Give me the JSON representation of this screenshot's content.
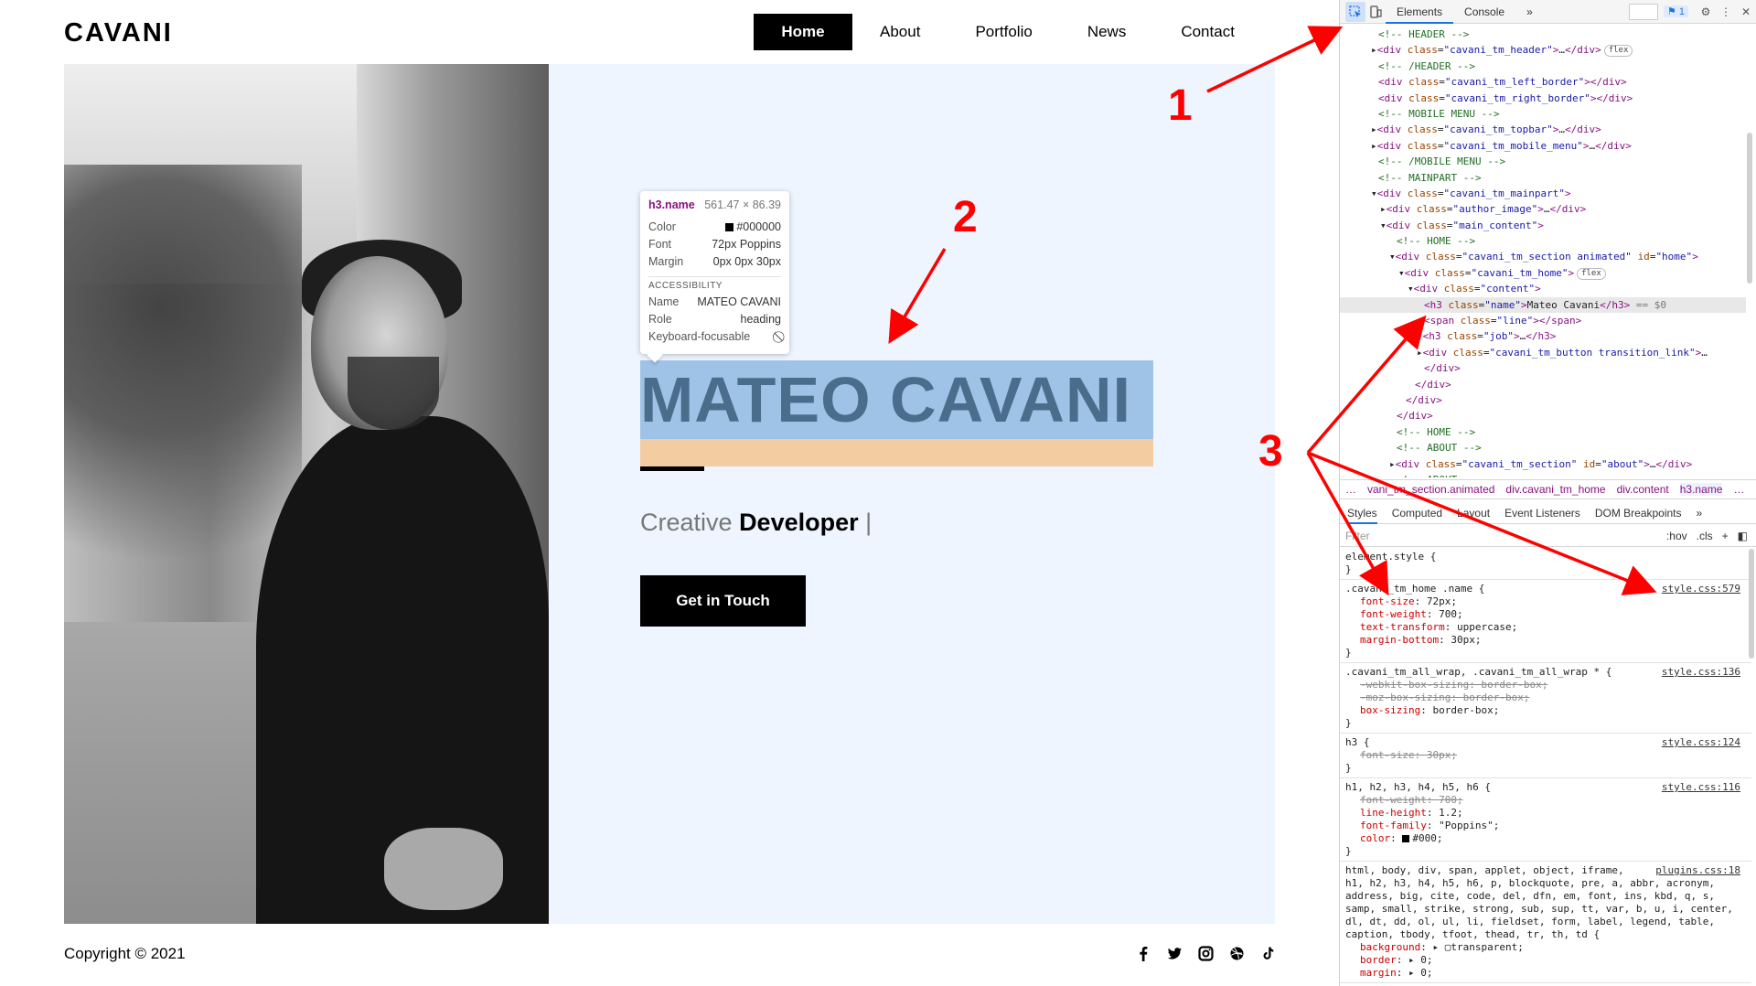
{
  "site": {
    "logo": "CAVANI",
    "nav": [
      "Home",
      "About",
      "Portfolio",
      "News",
      "Contact"
    ],
    "hero": {
      "name": "MATEO CAVANI",
      "job_prefix": "Creative",
      "job_strong": "Developer",
      "cursor": "|",
      "cta": "Get in Touch"
    },
    "footer": {
      "copyright": "Copyright © 2021"
    },
    "social_icons": [
      "facebook-icon",
      "twitter-icon",
      "instagram-icon",
      "dribbble-icon",
      "tiktok-icon"
    ],
    "colors": {
      "hero_bg": "#eef5ff",
      "highlight": "#9fc2e7",
      "margin_highlight": "#f3cca2",
      "name_text": "#4a6d8c"
    }
  },
  "tooltip": {
    "element": "h3.name",
    "size": "561.47 × 86.39",
    "rows": [
      {
        "k": "Color",
        "v": "#000000"
      },
      {
        "k": "Font",
        "v": "72px Poppins"
      },
      {
        "k": "Margin",
        "v": "0px 0px 30px"
      }
    ],
    "accessibility_title": "ACCESSIBILITY",
    "a11y": [
      {
        "k": "Name",
        "v": "MATEO CAVANI"
      },
      {
        "k": "Role",
        "v": "heading"
      },
      {
        "k": "Keyboard-focusable",
        "v": "⃠"
      }
    ]
  },
  "annotations": [
    "1",
    "2",
    "3"
  ],
  "devtools": {
    "tabs": [
      "Elements",
      "Console"
    ],
    "more": "»",
    "badge": "1",
    "dom_lines": [
      {
        "html": "<span class='cmt'>&lt;!-- HEADER --&gt;</span>",
        "indent": 42
      },
      {
        "html": "▸<span class='tag'>&lt;div</span> <span class='attr'>class</span>=<span class='val'>\"cavani_tm_header\"</span><span class='tag'>&gt;</span>…<span class='tag'>&lt;/div&gt;</span><span class='flex'>flex</span>",
        "indent": 34
      },
      {
        "html": "<span class='cmt'>&lt;!-- /HEADER --&gt;</span>",
        "indent": 42
      },
      {
        "html": "<span class='tag'>&lt;div</span> <span class='attr'>class</span>=<span class='val'>\"cavani_tm_left_border\"</span><span class='tag'>&gt;&lt;/div&gt;</span>",
        "indent": 42
      },
      {
        "html": "<span class='tag'>&lt;div</span> <span class='attr'>class</span>=<span class='val'>\"cavani_tm_right_border\"</span><span class='tag'>&gt;&lt;/div&gt;</span>",
        "indent": 42
      },
      {
        "html": "<span class='cmt'>&lt;!-- MOBILE MENU --&gt;</span>",
        "indent": 42
      },
      {
        "html": "▸<span class='tag'>&lt;div</span> <span class='attr'>class</span>=<span class='val'>\"cavani_tm_topbar\"</span><span class='tag'>&gt;</span>…<span class='tag'>&lt;/div&gt;</span>",
        "indent": 34
      },
      {
        "html": "▸<span class='tag'>&lt;div</span> <span class='attr'>class</span>=<span class='val'>\"cavani_tm_mobile_menu\"</span><span class='tag'>&gt;</span>…<span class='tag'>&lt;/div&gt;</span>",
        "indent": 34
      },
      {
        "html": "<span class='cmt'>&lt;!-- /MOBILE MENU --&gt;</span>",
        "indent": 42
      },
      {
        "html": "<span class='cmt'>&lt;!-- MAINPART --&gt;</span>",
        "indent": 42
      },
      {
        "html": "▾<span class='tag'>&lt;div</span> <span class='attr'>class</span>=<span class='val'>\"cavani_tm_mainpart\"</span><span class='tag'>&gt;</span>",
        "indent": 34
      },
      {
        "html": "▸<span class='tag'>&lt;div</span> <span class='attr'>class</span>=<span class='val'>\"author_image\"</span><span class='tag'>&gt;</span>…<span class='tag'>&lt;/div&gt;</span>",
        "indent": 44
      },
      {
        "html": "▾<span class='tag'>&lt;div</span> <span class='attr'>class</span>=<span class='val'>\"main_content\"</span><span class='tag'>&gt;</span>",
        "indent": 44
      },
      {
        "html": "<span class='cmt'>&lt;!-- HOME --&gt;</span>",
        "indent": 62
      },
      {
        "html": "▾<span class='tag'>&lt;div</span> <span class='attr'>class</span>=<span class='val'>\"cavani_tm_section animated\"</span> <span class='attr'>id</span>=<span class='val'>\"home\"</span><span class='tag'>&gt;</span>",
        "indent": 54
      },
      {
        "html": "▾<span class='tag'>&lt;div</span> <span class='attr'>class</span>=<span class='val'>\"cavani_tm_home\"</span><span class='tag'>&gt;</span><span class='flex'>flex</span>",
        "indent": 64
      },
      {
        "html": "▾<span class='tag'>&lt;div</span> <span class='attr'>class</span>=<span class='val'>\"content\"</span><span class='tag'>&gt;</span>",
        "indent": 74
      },
      {
        "html": "<span class='tag'>&lt;h3</span> <span class='attr'>class</span>=<span class='val'>\"name\"</span><span class='tag'>&gt;</span>Mateo Cavani<span class='tag'>&lt;/h3&gt;</span> <span style='color:#777'>== $0</span>",
        "indent": 92,
        "sel": true
      },
      {
        "html": "<span class='tag'>&lt;span</span> <span class='attr'>class</span>=<span class='val'>\"line\"</span><span class='tag'>&gt;&lt;/span&gt;</span>",
        "indent": 92
      },
      {
        "html": "▸<span class='tag'>&lt;h3</span> <span class='attr'>class</span>=<span class='val'>\"job\"</span><span class='tag'>&gt;</span>…<span class='tag'>&lt;/h3&gt;</span>",
        "indent": 84
      },
      {
        "html": "▸<span class='tag'>&lt;div</span> <span class='attr'>class</span>=<span class='val'>\"cavani_tm_button transition_link\"</span><span class='tag'>&gt;</span>…",
        "indent": 84
      },
      {
        "html": "<span class='tag'>&lt;/div&gt;</span>",
        "indent": 92
      },
      {
        "html": "<span class='tag'>&lt;/div&gt;</span>",
        "indent": 82
      },
      {
        "html": "<span class='tag'>&lt;/div&gt;</span>",
        "indent": 72
      },
      {
        "html": "<span class='tag'>&lt;/div&gt;</span>",
        "indent": 62
      },
      {
        "html": "<span class='cmt'>&lt;!-- HOME --&gt;</span>",
        "indent": 62
      },
      {
        "html": "<span class='cmt'>&lt;!-- ABOUT --&gt;</span>",
        "indent": 62
      },
      {
        "html": "▸<span class='tag'>&lt;div</span> <span class='attr'>class</span>=<span class='val'>\"cavani_tm_section\"</span> <span class='attr'>id</span>=<span class='val'>\"about\"</span><span class='tag'>&gt;</span>…<span class='tag'>&lt;/div&gt;</span>",
        "indent": 54
      },
      {
        "html": "<span class='cmt'>&lt;!-- ABOUT --&gt;</span>",
        "indent": 62
      }
    ],
    "crumbs": [
      "…",
      "vani_tm_section.animated",
      "div.cavani_tm_home",
      "div.content",
      "h3.name",
      "…"
    ],
    "style_tabs": [
      "Styles",
      "Computed",
      "Layout",
      "Event Listeners",
      "DOM Breakpoints",
      "»"
    ],
    "filter": {
      "placeholder": "Filter",
      "hov": ":hov",
      "cls": ".cls",
      "plus": "+"
    },
    "rules": [
      {
        "selector": "element.style {",
        "source": "",
        "decls": [],
        "close": "}"
      },
      {
        "selector": ".cavani_tm_home .name {",
        "source": "style.css:579",
        "decls": [
          {
            "p": "font-size",
            "v": "72px;"
          },
          {
            "p": "font-weight",
            "v": "700;"
          },
          {
            "p": "text-transform",
            "v": "uppercase;"
          },
          {
            "p": "margin-bottom",
            "v": "30px;"
          }
        ],
        "close": "}"
      },
      {
        "selector": ".cavani_tm_all_wrap, .cavani_tm_all_wrap * {",
        "source": "style.css:136",
        "decls": [
          {
            "p": "-webkit-box-sizing",
            "v": "border-box;",
            "strike": true
          },
          {
            "p": "-moz-box-sizing",
            "v": "border-box;",
            "strike": true
          },
          {
            "p": "box-sizing",
            "v": "border-box;"
          }
        ],
        "close": "}"
      },
      {
        "selector": "h3 {",
        "source": "style.css:124",
        "decls": [
          {
            "p": "font-size",
            "v": "30px;",
            "strike": true
          }
        ],
        "close": "}"
      },
      {
        "selector": "h1, h2, h3, h4, h5, h6 {",
        "source": "style.css:116",
        "decls": [
          {
            "p": "font-weight",
            "v": "700;",
            "strike": true
          },
          {
            "p": "line-height",
            "v": "1.2;"
          },
          {
            "p": "font-family",
            "v": "\"Poppins\";"
          },
          {
            "p": "color",
            "v": "#000;",
            "swatch": true
          }
        ],
        "close": "}"
      },
      {
        "selector": "html, body, div, span, applet, object, iframe,",
        "source": "plugins.css:18",
        "extra": [
          "h1, h2, h3, h4, h5, h6, p, blockquote, pre, a, abbr, acronym,",
          "address, big, cite, code, del, dfn, em, font, ins, kbd, q, s,",
          "samp, small, strike, strong, sub, sup, tt, var, b, u, i, center,",
          "dl, dt, dd, ol, ul, li, fieldset, form, label, legend, table,",
          "caption, tbody, tfoot, thead, tr, th, td {"
        ],
        "decls": [
          {
            "p": "background",
            "v": "▸ ▢transparent;"
          },
          {
            "p": "border",
            "v": "▸ 0;"
          },
          {
            "p": "margin",
            "v": "▸ 0;"
          }
        ],
        "close": ""
      }
    ]
  }
}
